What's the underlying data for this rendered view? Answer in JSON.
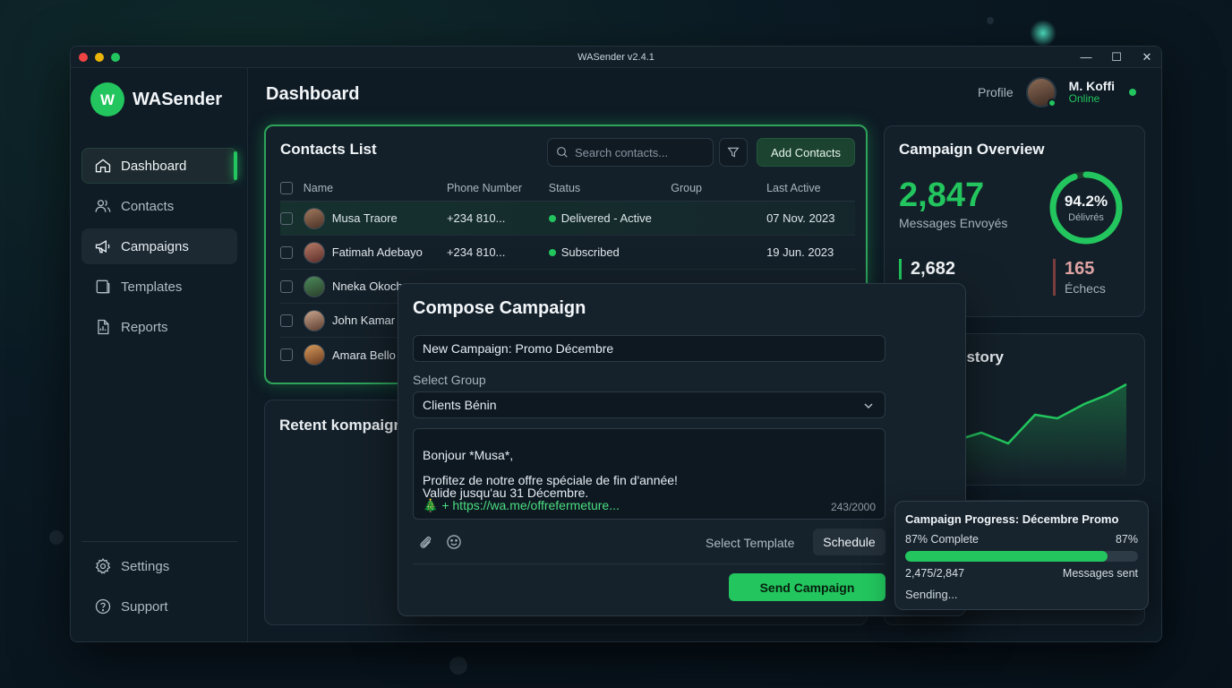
{
  "window": {
    "title": "WASender v2.4.1"
  },
  "brand": {
    "name": "WASender",
    "accent": "#22c55e"
  },
  "sidebar": {
    "items": [
      {
        "label": "Dashboard",
        "icon": "home-icon"
      },
      {
        "label": "Contacts",
        "icon": "users-icon"
      },
      {
        "label": "Campaigns",
        "icon": "megaphone-icon"
      },
      {
        "label": "Templates",
        "icon": "template-icon"
      },
      {
        "label": "Reports",
        "icon": "report-icon"
      }
    ],
    "bottom": [
      {
        "label": "Settings",
        "icon": "gear-icon"
      },
      {
        "label": "Support",
        "icon": "help-icon"
      }
    ]
  },
  "header": {
    "title": "Dashboard",
    "profile_label": "Profile",
    "user_name": "M. Koffi",
    "user_status": "Online"
  },
  "contacts": {
    "title": "Contacts List",
    "search_placeholder": "Search contacts...",
    "add_label": "Add Contacts",
    "columns": [
      "Name",
      "Phone Number",
      "Status",
      "Group",
      "Last Active"
    ],
    "rows": [
      {
        "name": "Musa Traore",
        "phone": "+234 810...",
        "status": "Delivered - Active",
        "group": "",
        "last": "07 Nov. 2023"
      },
      {
        "name": "Fatimah Adebayo",
        "phone": "+234 810...",
        "status": "Subscribed",
        "group": "",
        "last": "19 Jun. 2023"
      },
      {
        "name": "Nneka Okoch",
        "phone": "",
        "status": "",
        "group": "",
        "last": ""
      },
      {
        "name": "John Kamar",
        "phone": "",
        "status": "",
        "group": "",
        "last": ""
      },
      {
        "name": "Amara Bello",
        "phone": "",
        "status": "",
        "group": "",
        "last": ""
      }
    ]
  },
  "recent": {
    "title": "Retent kompaign"
  },
  "overview": {
    "title": "Campaign Overview",
    "sent_value": "2,847",
    "sent_label": "Messages Envoyés",
    "rate_value": "94.2%",
    "rate": 0.942,
    "rate_label": "Délivrés",
    "delivered_value": "2,682",
    "failed_value": "165",
    "failed_label": "Échecs"
  },
  "history": {
    "title": "listory"
  },
  "compose": {
    "title": "Compose Campaign",
    "campaign_name": "New Campaign: Promo Décembre",
    "group_label": "Select Group",
    "group_value": "Clients Bénin",
    "message_text": "Bonjour *Musa*,\n\nProfitez de notre offre spéciale de fin d'année!\nValide jusqu'au 31 Décembre.",
    "message_link": "🎄 + https://wa.me/offrefermeture...",
    "char_count": "243/2000",
    "template_label": "Select Template",
    "schedule_label": "Schedule",
    "send_label": "Send Campaign"
  },
  "progress": {
    "title": "Campaign Progress: Décembre Promo",
    "complete_label": "87% Complete",
    "percent_label": "87%",
    "fraction": 0.87,
    "count_label": "2,475/2,847",
    "sent_label": "Messages sent",
    "status_label": "Sending..."
  }
}
